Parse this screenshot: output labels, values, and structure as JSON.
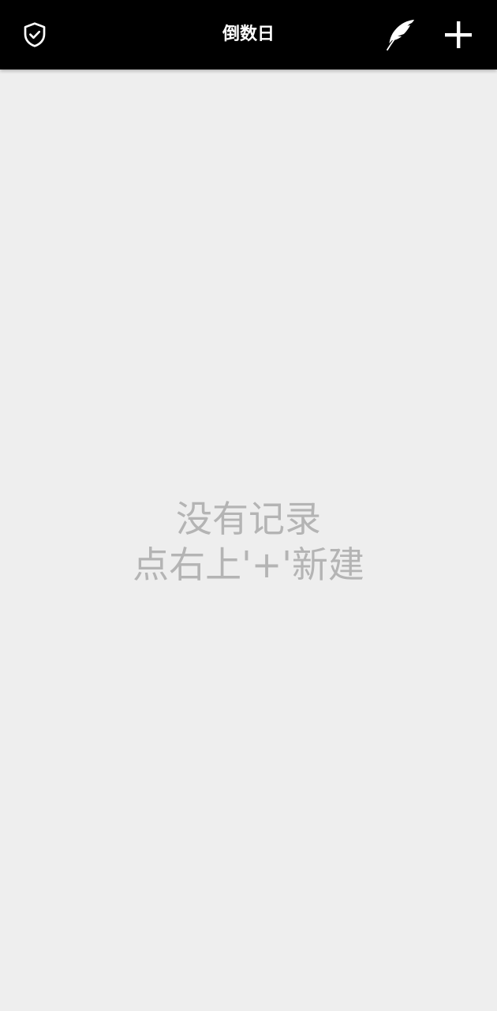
{
  "toolbar": {
    "title": "倒数日",
    "left_icon": "shield-check-icon",
    "right_icons": [
      "feather-icon",
      "plus-icon"
    ]
  },
  "empty_state": {
    "line1": "没有记录",
    "line2": "点右上'+'新建"
  },
  "colors": {
    "toolbar_bg": "#000000",
    "page_bg": "#eeeeee",
    "empty_text": "#b4b4b4",
    "icon": "#ffffff"
  }
}
